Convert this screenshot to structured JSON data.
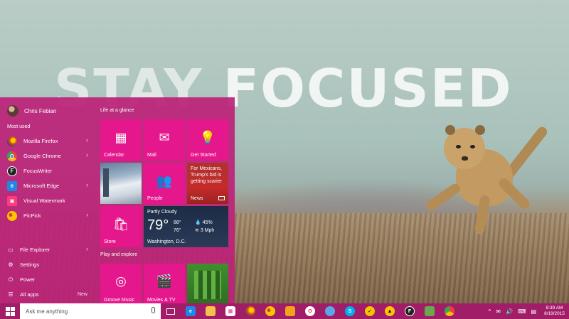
{
  "wallpaper": {
    "headline_a": "STAY",
    "headline_b": "FOCUSED"
  },
  "start_menu": {
    "user": "Chris Febian",
    "most_used_label": "Most used",
    "apps": [
      {
        "label": "Mozilla Firefox",
        "icon": "firefox-icon",
        "color": "#e66000",
        "glyph": "",
        "chevron": "›"
      },
      {
        "label": "Google Chrome",
        "icon": "chrome-icon",
        "color": "#34a853",
        "glyph": "",
        "chevron": "›"
      },
      {
        "label": "FocusWriter",
        "icon": "focuswriter-icon",
        "color": "#222222",
        "glyph": "F",
        "chevron": ""
      },
      {
        "label": "Microsoft Edge",
        "icon": "edge-icon",
        "color": "#1e88e5",
        "glyph": "e",
        "chevron": "›"
      },
      {
        "label": "Visual Watermark",
        "icon": "watermark-icon",
        "color": "#ff3b7f",
        "glyph": "🔒",
        "chevron": ""
      },
      {
        "label": "PicPick",
        "icon": "picpick-icon",
        "color": "#f7c600",
        "glyph": "",
        "chevron": "›"
      }
    ],
    "bottom": {
      "file_explorer": "File Explorer",
      "settings": "Settings",
      "power": "Power",
      "all_apps": "All apps",
      "new_badge": "New",
      "chevron": "›"
    },
    "life_label": "Life at a glance",
    "play_label": "Play and explore",
    "tiles": {
      "calendar": "Calendar",
      "mail": "Mail",
      "get_started": "Get Started",
      "people": "People",
      "news": "News",
      "news_headline": "For Mexicans, Trump's bid is getting scarier",
      "store": "Store",
      "groove": "Groove Music",
      "movies": "Movies & TV"
    },
    "weather": {
      "condition": "Partly Cloudy",
      "temp": "79°",
      "high": "88°",
      "low": "76°",
      "humidity": "45%",
      "wind": "3 Mph",
      "city": "Washington, D.C."
    }
  },
  "taskbar": {
    "search_placeholder": "Ask me anything",
    "time": "8:39 AM",
    "date": "8/19/2015",
    "tray_up": "^"
  },
  "colors": {
    "accent": "#e5178c",
    "menu_bg": "#bc2278",
    "taskbar_bg": "#a21d68"
  }
}
